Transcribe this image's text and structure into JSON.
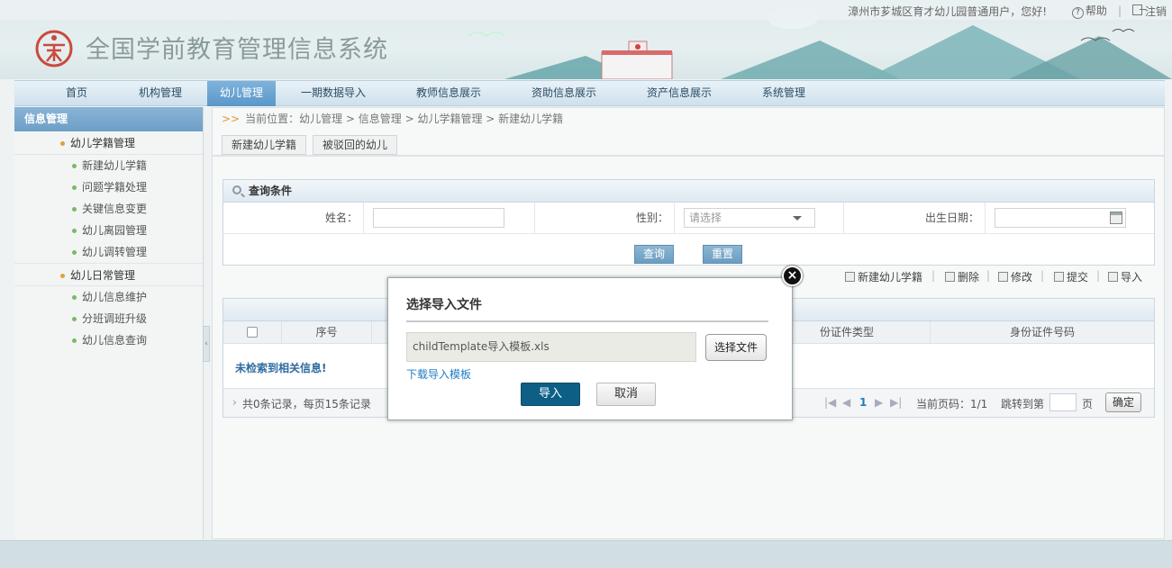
{
  "topbar": {
    "greeting": "漳州市芗城区育才幼儿园普通用户，您好!",
    "help": "帮助",
    "logout": "注销"
  },
  "header": {
    "title": "全国学前教育管理信息系统",
    "logo_icon": "kindergarten-logo-icon",
    "accent": "#c94a3d"
  },
  "nav": {
    "items": [
      {
        "label": "首页"
      },
      {
        "label": "机构管理"
      },
      {
        "label": "幼儿管理"
      },
      {
        "label": "一期数据导入"
      },
      {
        "label": "教师信息展示"
      },
      {
        "label": "资助信息展示"
      },
      {
        "label": "资产信息展示"
      },
      {
        "label": "系统管理"
      }
    ],
    "active_index": 2
  },
  "sidebar": {
    "title": "信息管理",
    "groups": [
      {
        "label": "幼儿学籍管理",
        "items": [
          "新建幼儿学籍",
          "问题学籍处理",
          "关键信息变更",
          "幼儿离园管理",
          "幼儿调转管理"
        ]
      },
      {
        "label": "幼儿日常管理",
        "items": [
          "幼儿信息维护",
          "分班调班升级",
          "幼儿信息查询"
        ]
      }
    ],
    "collapse_arrow": "‹"
  },
  "breadcrumb": {
    "arrows": ">>",
    "text": "当前位置：幼儿管理 > 信息管理 > 幼儿学籍管理 > 新建幼儿学籍"
  },
  "tabs": [
    {
      "label": "新建幼儿学籍"
    },
    {
      "label": "被驳回的幼儿"
    }
  ],
  "query": {
    "title": "查询条件",
    "name_label": "姓名：",
    "gender_label": "性别：",
    "gender_placeholder": "请选择",
    "birth_label": "出生日期：",
    "search_button": "查询",
    "reset_button": "重置"
  },
  "toolbar": {
    "new_label": "新建幼儿学籍",
    "delete_label": "删除",
    "edit_label": "修改",
    "submit_label": "提交",
    "import_label": "导入"
  },
  "grid": {
    "columns": [
      "序号",
      "份证件类型",
      "身份证件号码"
    ],
    "empty_message": "未检索到相关信息!",
    "pager": {
      "summary": "共0条记录，每页15条记录",
      "current_page": "1",
      "page_info": "当前页码：1/1",
      "jump_label": "跳转到第",
      "page_unit": "页",
      "confirm": "确定"
    }
  },
  "modal": {
    "title": "选择导入文件",
    "file_name": "childTemplate导入模板.xls",
    "choose_button": "选择文件",
    "download_link": "下载导入模板",
    "import_button": "导入",
    "cancel_button": "取消",
    "close_icon": "close-icon"
  }
}
